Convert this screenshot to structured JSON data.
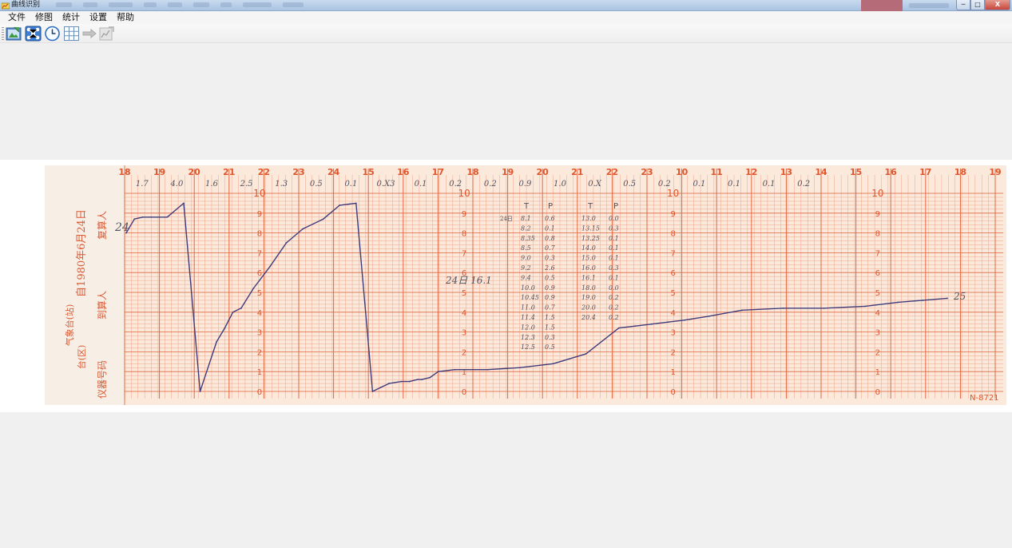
{
  "window": {
    "title": "曲线识别",
    "buttons": {
      "minimize": "─",
      "maximize": "□",
      "close": "X"
    }
  },
  "menu": [
    "文件",
    "修图",
    "统计",
    "设置",
    "帮助"
  ],
  "toolbar": {
    "buttons": [
      {
        "name": "open-image",
        "icon": "open-image-icon"
      },
      {
        "name": "recognize-curve",
        "icon": "network-icon"
      },
      {
        "name": "time-settings",
        "icon": "clock-icon"
      },
      {
        "name": "grid",
        "icon": "grid-icon"
      },
      {
        "name": "next",
        "icon": "arrow-right-icon",
        "disabled": true
      },
      {
        "name": "export",
        "icon": "export-chart-icon",
        "disabled": true
      }
    ]
  },
  "colors": {
    "paper": "#fbe9dc",
    "grid_fine": "#f0a487",
    "grid_major": "#e06a44",
    "header_text": "#e0562c",
    "curve": "#3f3b7a",
    "handwriting": "#53525e"
  },
  "chart_data": {
    "type": "line",
    "top_hours": [
      "18",
      "19",
      "20",
      "21",
      "22",
      "23",
      "24",
      "15",
      "16",
      "17",
      "18",
      "19",
      "20",
      "21",
      "22",
      "23",
      "10",
      "11",
      "12",
      "13",
      "14",
      "15",
      "16",
      "17",
      "18",
      "19"
    ],
    "top_values": [
      "1.7",
      "4.0",
      "1.6",
      "2.5",
      "1.3",
      "0.5",
      "0.1",
      "0.X3",
      "0.1",
      "0.2",
      "0.2",
      "0.9",
      "1.0",
      "0.X",
      "0.5",
      "0.2",
      "0.1",
      "0.1",
      "0.1",
      "0.2"
    ],
    "y_ticks": [
      "10",
      "9",
      "8",
      "7",
      "6",
      "5",
      "4",
      "3",
      "2",
      "1",
      "0"
    ],
    "y_range": [
      0,
      10
    ],
    "left_strip": {
      "date_line": "自1980年6月24日",
      "station_line": "气象台(站)",
      "signer_1": "复算人",
      "signer_2": "到算人",
      "instrument": "仪器号码",
      "unit": "台(区)"
    },
    "annotations": {
      "left_value": "24",
      "mid_label": "24日 16.1",
      "end_label": "25",
      "serial": "N-8721"
    },
    "table": {
      "headers": [
        "T",
        "P",
        "T",
        "P"
      ],
      "first_cell": "24日",
      "left_rows": [
        [
          "8.1",
          "0.6"
        ],
        [
          "8.2",
          "0.1"
        ],
        [
          "8.35",
          "0.8"
        ],
        [
          "8.5",
          "0.7"
        ],
        [
          "9.0",
          "0.3"
        ],
        [
          "9.2",
          "2.6"
        ],
        [
          "9.4",
          "0.5"
        ],
        [
          "10.0",
          "0.9"
        ],
        [
          "10.45",
          "0.9"
        ],
        [
          "11.0",
          "0.7"
        ],
        [
          "11.4",
          "1.5"
        ],
        [
          "12.0",
          "1.5"
        ],
        [
          "12.3",
          "0.3"
        ],
        [
          "12.5",
          "0.5"
        ]
      ],
      "right_rows": [
        [
          "13.0",
          "0.0"
        ],
        [
          "13.15",
          "0.3"
        ],
        [
          "13.25",
          "0.1"
        ],
        [
          "14.0",
          "0.1"
        ],
        [
          "15.0",
          "0.1"
        ],
        [
          "16.0",
          "0.3"
        ],
        [
          "16.1",
          "0.1"
        ],
        [
          "18.0",
          "0.0"
        ],
        [
          "19.0",
          "0.2"
        ],
        [
          "20.0",
          "0.2"
        ],
        [
          "20.4",
          "0.2"
        ]
      ]
    },
    "series": [
      {
        "x": [
          0.0,
          0.01,
          0.02,
          0.03,
          0.05,
          0.07,
          0.09,
          0.11,
          0.12,
          0.125,
          0.13,
          0.14,
          0.155,
          0.175,
          0.195,
          0.215,
          0.24,
          0.26,
          0.28,
          0.3,
          0.31,
          0.32,
          0.335,
          0.345,
          0.355,
          0.36,
          0.37,
          0.38,
          0.4,
          0.44,
          0.48,
          0.52,
          0.56,
          0.6,
          0.62,
          0.64,
          0.66,
          0.68,
          0.71,
          0.75,
          0.8,
          0.85,
          0.9,
          0.94,
          0.97,
          1.0
        ],
        "y": [
          8.0,
          8.7,
          8.8,
          8.8,
          8.8,
          9.5,
          0.0,
          2.5,
          3.2,
          3.6,
          4.0,
          4.2,
          5.2,
          6.3,
          7.5,
          8.2,
          8.7,
          9.4,
          9.5,
          0.0,
          0.2,
          0.4,
          0.5,
          0.5,
          0.6,
          0.6,
          0.7,
          1.0,
          1.1,
          1.1,
          1.2,
          1.4,
          1.9,
          3.2,
          3.3,
          3.4,
          3.5,
          3.6,
          3.8,
          4.1,
          4.2,
          4.2,
          4.3,
          4.5,
          4.6,
          4.7
        ]
      }
    ]
  }
}
